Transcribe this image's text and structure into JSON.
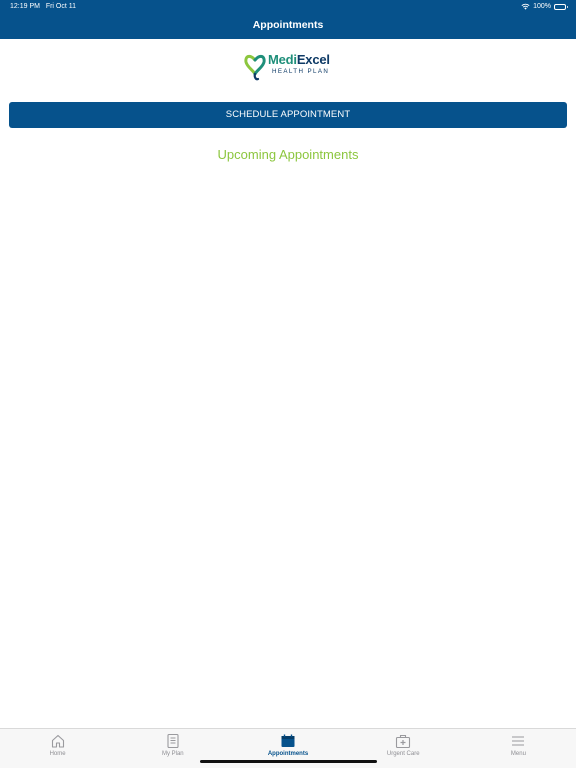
{
  "status_bar": {
    "time": "12:19 PM",
    "date": "Fri Oct 11",
    "battery": "100%"
  },
  "header": {
    "title": "Appointments"
  },
  "logo": {
    "name_part1": "Medi",
    "name_part2": "Excel",
    "subtitle": "HEALTH PLAN"
  },
  "actions": {
    "schedule_label": "SCHEDULE APPOINTMENT"
  },
  "section": {
    "title": "Upcoming Appointments"
  },
  "tabs": [
    {
      "label": "Home",
      "icon": "home-icon",
      "active": false
    },
    {
      "label": "My Plan",
      "icon": "document-icon",
      "active": false
    },
    {
      "label": "Appointments",
      "icon": "calendar-icon",
      "active": true
    },
    {
      "label": "Urgent Care",
      "icon": "medical-bag-icon",
      "active": false
    },
    {
      "label": "Menu",
      "icon": "menu-icon",
      "active": false
    }
  ],
  "colors": {
    "primary": "#06528c",
    "accent_green": "#8cc63e",
    "inactive": "#8e8e93"
  }
}
